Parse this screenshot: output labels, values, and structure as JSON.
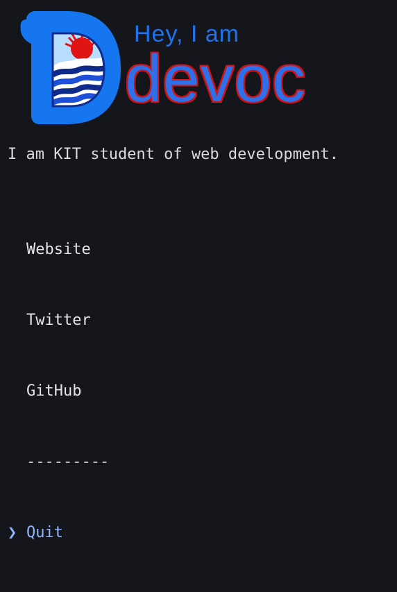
{
  "header": {
    "greeting": "Hey, I am",
    "name": "devoc",
    "logo_icon": "d-logo-icon"
  },
  "intro": {
    "text": "I am KIT student of web development."
  },
  "menu": {
    "pointer": "❯",
    "items": [
      {
        "label": "Website",
        "selected": false
      },
      {
        "label": "Twitter",
        "selected": false
      },
      {
        "label": "GitHub",
        "selected": false
      },
      {
        "label": "---------",
        "separator": true
      },
      {
        "label": "Quit",
        "selected": true
      }
    ]
  },
  "colors": {
    "background": "#15161b",
    "text": "#d8dae0",
    "accent": "#8eb4ff",
    "title_blue": "#2f6fe8",
    "title_outline": "#d11212"
  }
}
